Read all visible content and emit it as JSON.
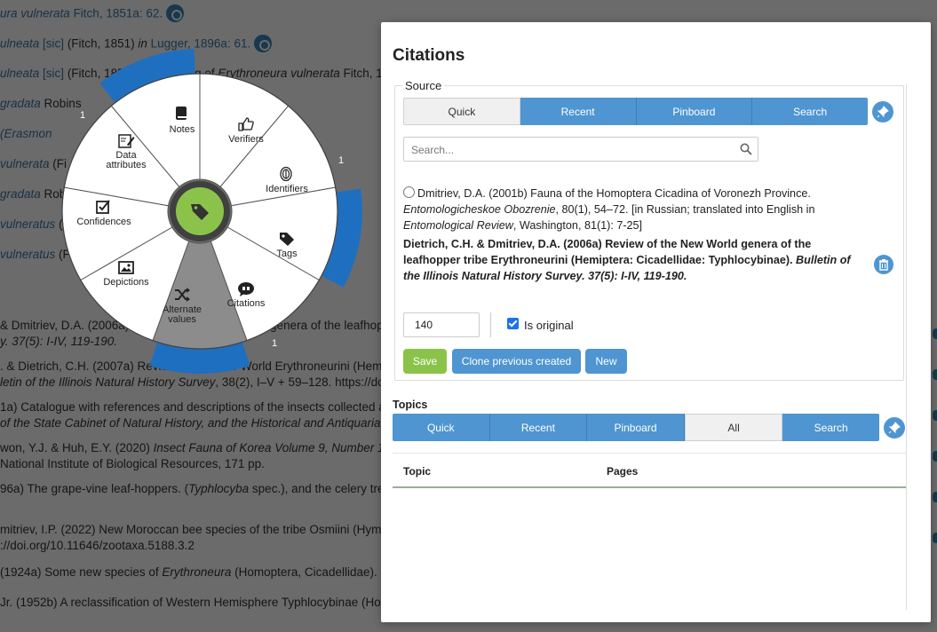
{
  "background": {
    "lines": [
      {
        "parts": [
          {
            "t": "ura vulnerata",
            "k": "lnk-i"
          },
          {
            "t": " Fitch, 1851a: 62.",
            "k": "lnk"
          },
          {
            "t": "",
            "k": "gear"
          }
        ]
      },
      {
        "parts": [
          {
            "t": "ulneata",
            "k": "lnk-i"
          },
          {
            "t": " [sic]",
            "k": "lnk"
          },
          {
            "t": " (Fitch, 1851) ",
            "k": "txt"
          },
          {
            "t": "in",
            "k": "i"
          },
          {
            "t": " Lugger, 1896a: 61.",
            "k": "lnk"
          },
          {
            "t": "",
            "k": "gear"
          }
        ]
      },
      {
        "parts": [
          {
            "t": "ulneata",
            "k": "lnk-i"
          },
          {
            "t": " [sic]",
            "k": "lnk"
          },
          {
            "t": " (Fitch, 1851) (misspelling of ",
            "k": "txt"
          },
          {
            "t": "Erythroneura vulnerata",
            "k": "i"
          },
          {
            "t": " Fitch, 18",
            "k": "txt"
          }
        ]
      },
      {
        "parts": [
          {
            "t": " gradata",
            "k": "lnk-i"
          },
          {
            "t": " Robins",
            "k": "txt"
          }
        ]
      },
      {
        "parts": [
          {
            "t": " (Erasmon",
            "k": "lnk-i"
          }
        ]
      },
      {
        "parts": [
          {
            "t": " vulnerata",
            "k": "lnk-i"
          },
          {
            "t": " (Fi",
            "k": "txt"
          }
        ]
      },
      {
        "parts": [
          {
            "t": " gradata",
            "k": "lnk-i"
          },
          {
            "t": " Rob",
            "k": "txt"
          }
        ]
      },
      {
        "parts": [
          {
            "t": "vulneratus",
            "k": "lnk-i"
          },
          {
            "t": " (F",
            "k": "txt"
          }
        ]
      },
      {
        "parts": [
          {
            "t": "vulneratus",
            "k": "lnk-i"
          },
          {
            "t": " (F",
            "k": "txt"
          }
        ]
      },
      {
        "parts": [
          {
            "t": " & Dmitriev, D.A. (2006a) Review of the New World genera of the leafhopper tribe",
            "k": "txt"
          }
        ]
      },
      {
        "parts": [
          {
            "t": "y. 37(5): I-IV, 119-190.",
            "k": "i"
          }
        ]
      },
      {
        "parts": [
          {
            "t": ". & Dietrich, C.H. (2007a) Review of the New World Erythroneurini (Hemipte",
            "k": "txt"
          }
        ]
      },
      {
        "parts": [
          {
            "t": "letin of the Illinois Natural History Survey",
            "k": "i"
          },
          {
            "t": ", 38(2), I–V + 59–128. https://doi",
            "k": "txt"
          }
        ]
      },
      {
        "parts": [
          {
            "t": "1a) Catalogue with references and descriptions of the insects collected and",
            "k": "txt"
          }
        ]
      },
      {
        "parts": [
          {
            "t": " of the State Cabinet of Natural History, and the Historical and Antiquarian",
            "k": "i"
          }
        ]
      },
      {
        "parts": [
          {
            "t": "won, Y.J. & Huh, E.Y. (2020) ",
            "k": "txt"
          },
          {
            "t": "Insect Fauna of Korea Volume 9, Number 10 L",
            "k": "i"
          }
        ]
      },
      {
        "parts": [
          {
            "t": " National Institute of Biological Resources, 171 pp.",
            "k": "txt"
          }
        ]
      },
      {
        "parts": [
          {
            "t": "96a) The grape-vine leaf-hoppers. (",
            "k": "txt"
          },
          {
            "t": "Typhlocyba",
            "k": "i"
          },
          {
            "t": " spec.), and the celery tree",
            "k": "txt"
          }
        ]
      },
      {
        "parts": [
          {
            "t": "mitriev, I.P. (2022) New Moroccan bee species of the tribe Osmiini (Hymen",
            "k": "txt"
          }
        ]
      },
      {
        "parts": [
          {
            "t": "://doi.org/10.11646/zootaxa.5188.3.2",
            "k": "txt"
          }
        ]
      },
      {
        "parts": [
          {
            "t": " (1924a) Some new species of ",
            "k": "txt"
          },
          {
            "t": "Erythroneura",
            "k": "i"
          },
          {
            "t": " (Homoptera, Cicadellidae). ",
            "k": "txt"
          },
          {
            "t": "Th",
            "k": "i"
          }
        ]
      },
      {
        "parts": [
          {
            "t": "Jr. (1952b) A reclassification of Western Hemisphere Typhlocybinae (Homo",
            "k": "txt"
          }
        ]
      }
    ]
  },
  "radial_menu": {
    "sectors": [
      {
        "key": "notes",
        "label": "Notes",
        "icon": "book-icon"
      },
      {
        "key": "verifiers",
        "label": "Verifiers",
        "icon": "thumbs-up-icon"
      },
      {
        "key": "identifiers",
        "label": "Identifiers",
        "icon": "fingerprint-icon"
      },
      {
        "key": "tags",
        "label": "Tags",
        "icon": "tag-icon"
      },
      {
        "key": "citations",
        "label": "Citations",
        "icon": "quote-icon"
      },
      {
        "key": "alternate_values",
        "label": "Alternate values",
        "icon": "shuffle-icon"
      },
      {
        "key": "depictions",
        "label": "Depictions",
        "icon": "image-icon"
      },
      {
        "key": "confidences",
        "label": "Confidences",
        "icon": "checkbox-icon"
      },
      {
        "key": "data_attributes",
        "label": "Data attributes",
        "icon": "edit-icon"
      }
    ],
    "counts": {
      "data_attributes": "1",
      "identifiers": "1",
      "citations": "1"
    },
    "center_icon": "tag-icon",
    "colors": {
      "count_arc": "#1f6fc0",
      "active_sector": "#8c8c8c",
      "center": "#8bc34a"
    }
  },
  "modal": {
    "title": "Citations",
    "source": {
      "legend": "Source",
      "tabs": [
        "Quick",
        "Recent",
        "Pinboard",
        "Search"
      ],
      "active_tab": "Quick",
      "search_placeholder": "Search...",
      "citations": [
        {
          "a": "Dmitriev, D.A. (2001b) Fauna of the Homoptera Cicadina of Voronezh Province. ",
          "b": "Entomologicheskoe Obozrenie",
          "c": ", 80(1), 54–72. [in Russian; translated into English in ",
          "d": "Entomological Review",
          "e": ", Washington, 81(1): 7-25]"
        },
        {
          "a": "Dietrich, C.H. & Dmitriev, D.A. (2006a) Review of the New World genera of the leafhopper tribe Erythroneurini (Hemiptera: Cicadellidae: Typhlocybinae). ",
          "b": "Bulletin of the Illinois Natural History Survey. 37(5): I-IV, 119-190."
        }
      ],
      "pages_value": "140",
      "is_original_label": "Is original",
      "buttons": {
        "save": "Save",
        "clone": "Clone previous created",
        "new": "New"
      }
    },
    "topics": {
      "title": "Topics",
      "tabs": [
        "Quick",
        "Recent",
        "Pinboard",
        "All",
        "Search"
      ],
      "active_tab": "All",
      "columns": [
        "Topic",
        "Pages"
      ]
    }
  }
}
